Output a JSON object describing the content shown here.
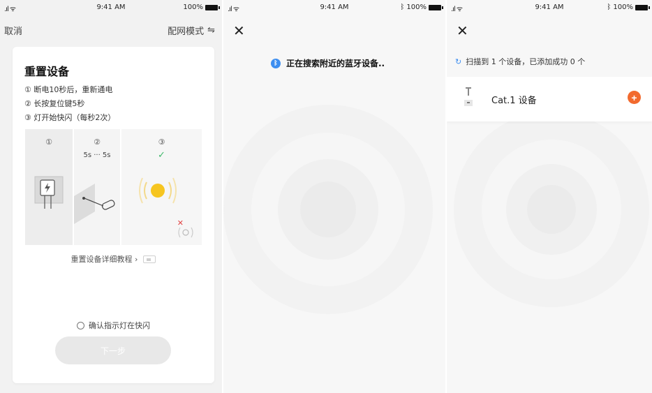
{
  "colors": {
    "accent_blue": "#3d8ef0",
    "add_orange": "#f26a2e",
    "check_green": "#3fb96b",
    "error_red": "#e24343",
    "indicator_yellow": "#f6c520"
  },
  "screen1": {
    "status": {
      "time": "9:41 AM",
      "battery": "100%"
    },
    "nav": {
      "cancel": "取消",
      "mode": "配网模式",
      "mode_icon": "switch-icon"
    },
    "card": {
      "title": "重置设备",
      "steps": [
        "① 断电10秒后，重新通电",
        "② 长按复位键5秒",
        "③ 灯开始快闪（每秒2次）"
      ],
      "illustration": {
        "step1_num": "①",
        "step2_num": "②",
        "step2_text": "5s ··· 5s",
        "step3_num": "③"
      },
      "tutorial": "重置设备详细教程 ›",
      "confirm": "确认指示灯在快闪",
      "next": "下一步"
    }
  },
  "screen2": {
    "status": {
      "time": "9:41 AM",
      "battery": "100%"
    },
    "searching": "正在搜索附近的蓝牙设备.."
  },
  "screen3": {
    "status": {
      "time": "9:41 AM",
      "battery": "100%"
    },
    "scan_result": "扫描到 1 个设备，已添加成功 0 个",
    "device": {
      "name": "Cat.1 设备",
      "add_label": "+"
    }
  }
}
